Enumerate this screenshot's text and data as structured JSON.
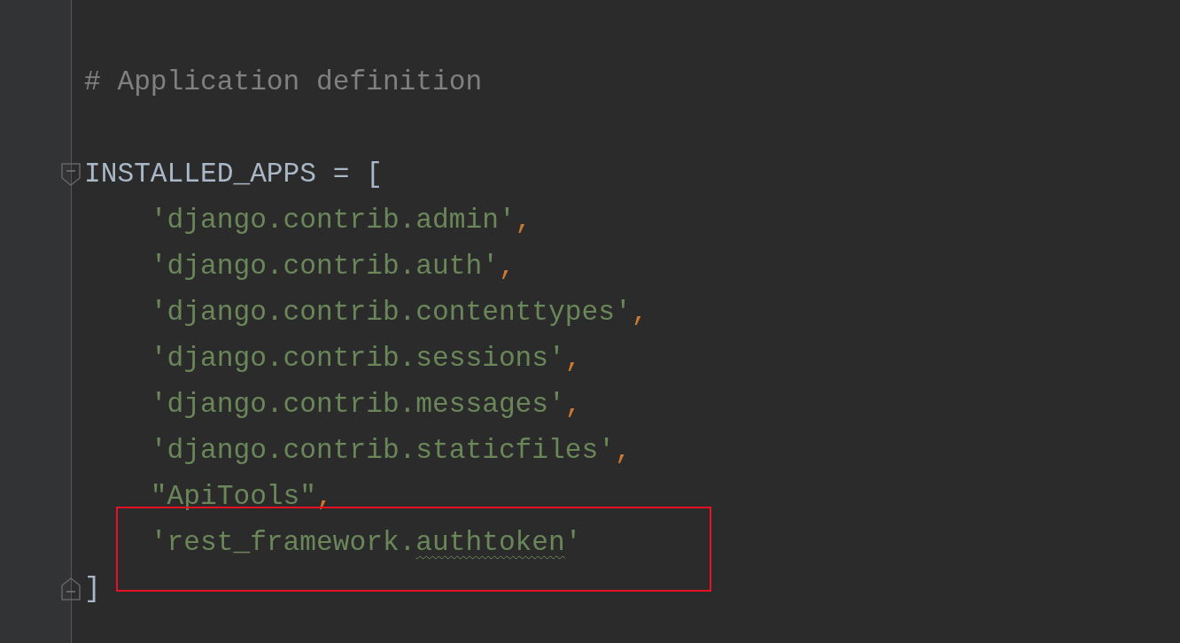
{
  "code_lines": [
    {
      "kind": "plain",
      "tokens": [
        {
          "kind": "comment",
          "text": "# Application definition"
        }
      ]
    },
    {
      "kind": "plain"
    },
    {
      "kind": "fold_start",
      "tokens": [
        {
          "kind": "ident",
          "text": "INSTALLED_APPS = ["
        }
      ]
    },
    {
      "kind": "plain",
      "tokens": [
        {
          "kind": "string",
          "text": "    'django.contrib.admin'"
        },
        {
          "kind": "punct",
          "text": ","
        }
      ]
    },
    {
      "kind": "plain",
      "tokens": [
        {
          "kind": "string",
          "text": "    'django.contrib.auth'"
        },
        {
          "kind": "punct",
          "text": ","
        }
      ]
    },
    {
      "kind": "plain",
      "tokens": [
        {
          "kind": "string",
          "text": "    'django.contrib.contenttypes'"
        },
        {
          "kind": "punct",
          "text": ","
        }
      ]
    },
    {
      "kind": "plain",
      "tokens": [
        {
          "kind": "string",
          "text": "    'django.contrib.sessions'"
        },
        {
          "kind": "punct",
          "text": ","
        }
      ]
    },
    {
      "kind": "plain",
      "tokens": [
        {
          "kind": "string",
          "text": "    'django.contrib.messages'"
        },
        {
          "kind": "punct",
          "text": ","
        }
      ]
    },
    {
      "kind": "plain",
      "tokens": [
        {
          "kind": "string",
          "text": "    'django.contrib.staticfiles'"
        },
        {
          "kind": "punct",
          "text": ","
        }
      ]
    },
    {
      "kind": "plain",
      "tokens": [
        {
          "kind": "string",
          "text": "    \"ApiTools\""
        },
        {
          "kind": "punct",
          "text": ","
        }
      ]
    },
    {
      "kind": "plain",
      "tokens": [
        {
          "kind": "string",
          "text": "    'rest_framework."
        },
        {
          "kind": "typo",
          "text": "authtoken"
        },
        {
          "kind": "string",
          "text": "'"
        }
      ]
    },
    {
      "kind": "fold_end",
      "tokens": [
        {
          "kind": "ident",
          "text": "]"
        }
      ]
    }
  ]
}
